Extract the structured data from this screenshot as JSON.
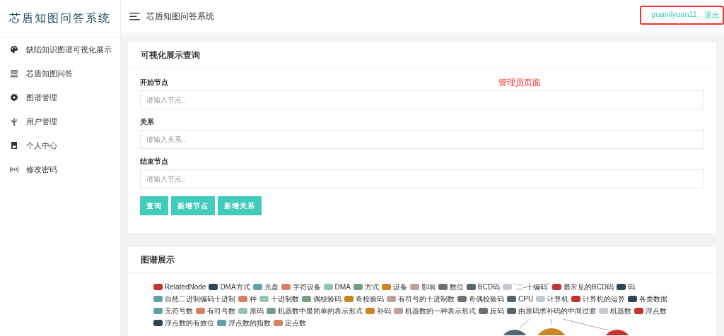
{
  "sidebar": {
    "logo": "芯盾知图问答系统",
    "items": [
      {
        "label": "缺陷知识图谱可视化展示"
      },
      {
        "label": "芯盾知图问答"
      },
      {
        "label": "图谱管理"
      },
      {
        "label": "用户管理"
      },
      {
        "label": "个人中心"
      },
      {
        "label": "修改密码"
      }
    ]
  },
  "header": {
    "title": "芯盾知图问答系统",
    "username": "guanliyuan11",
    "logout": "退出"
  },
  "annotation": "管理员页面",
  "query_panel": {
    "title": "可视化展示查询",
    "fields": [
      {
        "label": "开始节点",
        "placeholder": "请输入节点.."
      },
      {
        "label": "关系",
        "placeholder": "请输入关系.."
      },
      {
        "label": "结束节点",
        "placeholder": "请输入节点.."
      }
    ],
    "buttons": [
      "查询",
      "新增节点",
      "新增关系"
    ]
  },
  "graph_panel": {
    "title": "图谱展示",
    "legend_rows": [
      [
        {
          "label": "RelatedNode",
          "color": "#c23531"
        },
        {
          "label": "DMA方式",
          "color": "#2f4554"
        },
        {
          "label": "光盘",
          "color": "#61a0a8"
        },
        {
          "label": "字符设备",
          "color": "#d48265"
        },
        {
          "label": "DMA",
          "color": "#91c7ae"
        },
        {
          "label": "方式",
          "color": "#749f83"
        },
        {
          "label": "设备",
          "color": "#ca8622"
        },
        {
          "label": "影响",
          "color": "#bda29a"
        },
        {
          "label": "数位",
          "color": "#6e7074"
        },
        {
          "label": "BCD码",
          "color": "#546570"
        },
        {
          "label": "`二-十编码`",
          "color": "#c4ccd3"
        },
        {
          "label": "最常见的BCD码",
          "color": "#c23531"
        },
        {
          "label": "码",
          "color": "#2f4554"
        }
      ],
      [
        {
          "label": "自然二进制编码十进制",
          "color": "#61a0a8"
        },
        {
          "label": "种",
          "color": "#d48265"
        },
        {
          "label": "十进制数",
          "color": "#91c7ae"
        },
        {
          "label": "偶校验码",
          "color": "#749f83"
        },
        {
          "label": "奇校验码",
          "color": "#ca8622"
        },
        {
          "label": "有符号的十进制数",
          "color": "#bda29a"
        },
        {
          "label": "奇偶校验码",
          "color": "#6e7074"
        },
        {
          "label": "CPU",
          "color": "#546570"
        },
        {
          "label": "计算机",
          "color": "#c4ccd3"
        },
        {
          "label": "计算机的运算",
          "color": "#c23531"
        },
        {
          "label": "各类数据",
          "color": "#2f4554"
        }
      ],
      [
        {
          "label": "无符号数",
          "color": "#61a0a8"
        },
        {
          "label": "有符号数",
          "color": "#d48265"
        },
        {
          "label": "原码",
          "color": "#91c7ae"
        },
        {
          "label": "机器数中最简单的表示形式",
          "color": "#749f83"
        },
        {
          "label": "补码",
          "color": "#ca8622"
        },
        {
          "label": "机器数的一种表示形式",
          "color": "#bda29a"
        },
        {
          "label": "反码",
          "color": "#6e7074"
        },
        {
          "label": "由原码求补码的中间过渡",
          "color": "#546570"
        },
        {
          "label": "机器数",
          "color": "#c4ccd3"
        },
        {
          "label": "浮点数",
          "color": "#c23531"
        }
      ],
      [
        {
          "label": "浮点数的有效位",
          "color": "#2f4554"
        },
        {
          "label": "浮点数的指数",
          "color": "#61a0a8"
        },
        {
          "label": "定点数",
          "color": "#d48265"
        }
      ]
    ]
  }
}
